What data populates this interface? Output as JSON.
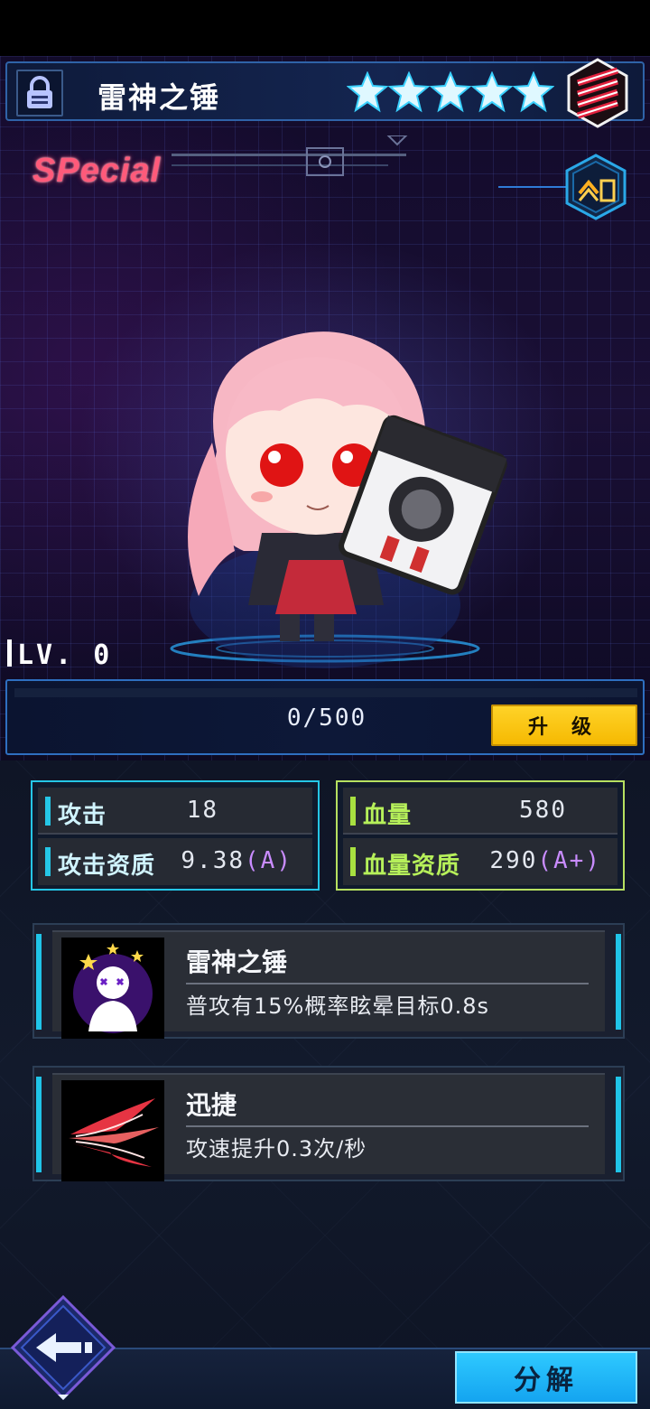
{
  "header": {
    "weapon_name": "雷神之锤",
    "star_count": 5,
    "rarity_logo": "SPecial"
  },
  "level": {
    "label": "LV. 0",
    "exp_text": "0/500",
    "exp_progress": 0,
    "upgrade_label": "升 级"
  },
  "stats": {
    "attack": {
      "label": "攻击",
      "value": "18",
      "quality_label": "攻击资质",
      "quality_value": "9.38",
      "quality_grade": "(A)"
    },
    "hp": {
      "label": "血量",
      "value": "580",
      "quality_label": "血量资质",
      "quality_value": "290",
      "quality_grade": "(A+)"
    }
  },
  "skills": [
    {
      "name": "雷神之锤",
      "desc": "普攻有15%概率眩晕目标0.8s",
      "icon": "stun-icon"
    },
    {
      "name": "迅捷",
      "desc": "攻速提升0.3次/秒",
      "icon": "swift-slash-icon"
    }
  ],
  "footer": {
    "decompose_label": "分解"
  },
  "colors": {
    "accent_cyan": "#25c6e6",
    "accent_green": "#b6e060",
    "upgrade_yellow": "#ffd42a",
    "grade_purple": "#c98cff",
    "special_pink": "#ff5a7a"
  }
}
